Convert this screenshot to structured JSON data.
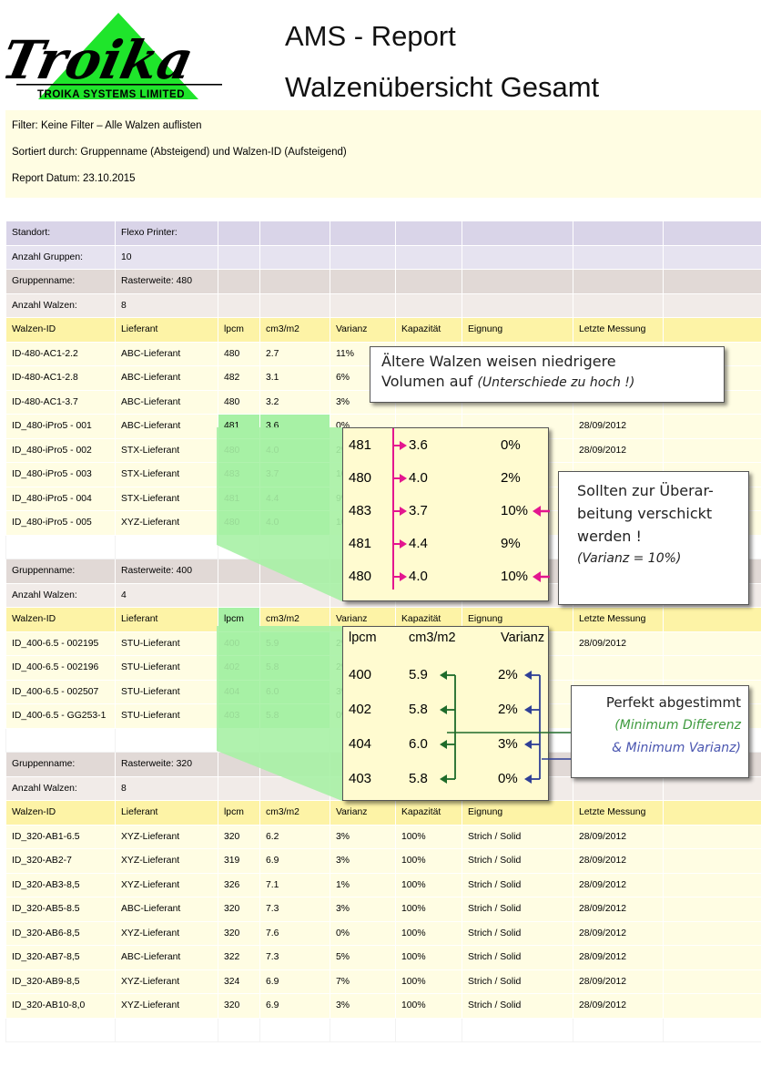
{
  "header": {
    "logo_text": "Troika",
    "logo_company": "TROIKA SYSTEMS LIMITED",
    "title_line1": "AMS - Report",
    "title_line2": "Walzenübersicht Gesamt"
  },
  "info": {
    "filter": "Filter:  Keine Filter – Alle Walzen auflisten",
    "sort": "Sortiert durch:  Gruppenname (Absteigend) und Walzen-ID (Aufsteigend)",
    "date": "Report Datum: 23.10.2015"
  },
  "meta": {
    "location_label": "Standort:",
    "location_value": "Flexo Printer:",
    "groups_label": "Anzahl Gruppen:",
    "groups_value": "10"
  },
  "columns": [
    "Walzen-ID",
    "Lieferant",
    "lpcm",
    "cm3/m2",
    "Varianz",
    "Kapazität",
    "Eignung",
    "Letzte Messung"
  ],
  "groups": [
    {
      "name_label": "Gruppenname:",
      "name": "Rasterweite: 480",
      "count_label": "Anzahl Walzen:",
      "count": "8",
      "rows": [
        [
          "ID-480-AC1-2.2",
          "ABC-Lieferant",
          "480",
          "2.7",
          "11%",
          "",
          "",
          ""
        ],
        [
          "ID-480-AC1-2.8",
          "ABC-Lieferant",
          "482",
          "3.1",
          "6%",
          "",
          "",
          ""
        ],
        [
          "ID-480-AC1-3.7",
          "ABC-Lieferant",
          "480",
          "3.2",
          "3%",
          "",
          "",
          ""
        ],
        [
          "ID_480-iPro5 - 001",
          "ABC-Lieferant",
          "481",
          "3.6",
          "0%",
          "",
          "",
          "28/09/2012"
        ],
        [
          "ID_480-iPro5 - 002",
          "STX-Lieferant",
          "480",
          "4.0",
          "2%",
          "",
          "",
          "28/09/2012"
        ],
        [
          "ID_480-iPro5 - 003",
          "STX-Lieferant",
          "483",
          "3.7",
          "10%",
          "",
          "",
          ""
        ],
        [
          "ID_480-iPro5 - 004",
          "STX-Lieferant",
          "481",
          "4.4",
          "9%",
          "",
          "",
          ""
        ],
        [
          "ID_480-iPro5 - 005",
          "XYZ-Lieferant",
          "480",
          "4.0",
          "10%",
          "",
          "",
          ""
        ]
      ]
    },
    {
      "name_label": "Gruppenname:",
      "name": "Rasterweite: 400",
      "count_label": "Anzahl Walzen:",
      "count": "4",
      "rows": [
        [
          "ID_400-6.5 - 002195",
          "STU-Lieferant",
          "400",
          "5.9",
          "2%",
          "",
          "",
          "28/09/2012"
        ],
        [
          "ID_400-6.5 - 002196",
          "STU-Lieferant",
          "402",
          "5.8",
          "2%",
          "",
          "",
          ""
        ],
        [
          "ID_400-6.5 - 002507",
          "STU-Lieferant",
          "404",
          "6.0",
          "3%",
          "",
          "",
          ""
        ],
        [
          "ID_400-6.5 - GG253-1",
          "STU-Lieferant",
          "403",
          "5.8",
          "0%",
          "",
          "",
          ""
        ]
      ]
    },
    {
      "name_label": "Gruppenname:",
      "name": "Rasterweite: 320",
      "count_label": "Anzahl Walzen:",
      "count": "8",
      "rows": [
        [
          "ID_320-AB1-6.5",
          "XYZ-Lieferant",
          "320",
          "6.2",
          "3%",
          "100%",
          "Strich / Solid",
          "28/09/2012"
        ],
        [
          "ID_320-AB2-7",
          "XYZ-Lieferant",
          "319",
          "6.9",
          "3%",
          "100%",
          "Strich / Solid",
          "28/09/2012"
        ],
        [
          "ID_320-AB3-8,5",
          "XYZ-Lieferant",
          "326",
          "7.1",
          "1%",
          "100%",
          "Strich / Solid",
          "28/09/2012"
        ],
        [
          "ID_320-AB5-8.5",
          "ABC-Lieferant",
          "320",
          "7.3",
          "3%",
          "100%",
          "Strich / Solid",
          "28/09/2012"
        ],
        [
          "ID_320-AB6-8,5",
          "XYZ-Lieferant",
          "320",
          "7.6",
          "0%",
          "100%",
          "Strich / Solid",
          "28/09/2012"
        ],
        [
          "ID_320-AB7-8,5",
          "ABC-Lieferant",
          "322",
          "7.3",
          "5%",
          "100%",
          "Strich / Solid",
          "28/09/2012"
        ],
        [
          "ID_320-AB9-8,5",
          "XYZ-Lieferant",
          "324",
          "6.9",
          "7%",
          "100%",
          "Strich / Solid",
          "28/09/2012"
        ],
        [
          "ID_320-AB10-8,0",
          "XYZ-Lieferant",
          "320",
          "6.9",
          "3%",
          "100%",
          "Strich / Solid",
          "28/09/2012"
        ]
      ]
    }
  ],
  "zoom480": [
    [
      "481",
      "3.6",
      "0%"
    ],
    [
      "480",
      "4.0",
      "2%"
    ],
    [
      "483",
      "3.7",
      "10%"
    ],
    [
      "481",
      "4.4",
      "9%"
    ],
    [
      "480",
      "4.0",
      "10%"
    ]
  ],
  "zoom400": {
    "headers": [
      "lpcm",
      "cm3/m2",
      "Varianz"
    ],
    "rows": [
      [
        "400",
        "5.9",
        "2%"
      ],
      [
        "402",
        "5.8",
        "2%"
      ],
      [
        "404",
        "6.0",
        "3%"
      ],
      [
        "403",
        "5.8",
        "0%"
      ]
    ]
  },
  "callouts": {
    "older_line1": "Ältere Walzen weisen niedrigere",
    "older_line2": "Volumen auf ",
    "older_italic": "(Unterschiede zu hoch !)",
    "rework_lines": [
      "Sollten zur Überar-",
      "beitung verschickt",
      "werden !"
    ],
    "rework_italic": "(Varianz = 10%)",
    "perfect_line1": "Perfekt abgestimmt",
    "perfect_line2": "(Minimum Differenz",
    "perfect_line3": "& Minimum Varianz)"
  },
  "colors": {
    "magenta": "#e3168f",
    "dark_green": "#1e6b2a",
    "navy": "#2f3f96",
    "highlight_green": "#a7f1a5",
    "italic_green": "#3e9a3e",
    "italic_blue": "#4a56b0"
  }
}
